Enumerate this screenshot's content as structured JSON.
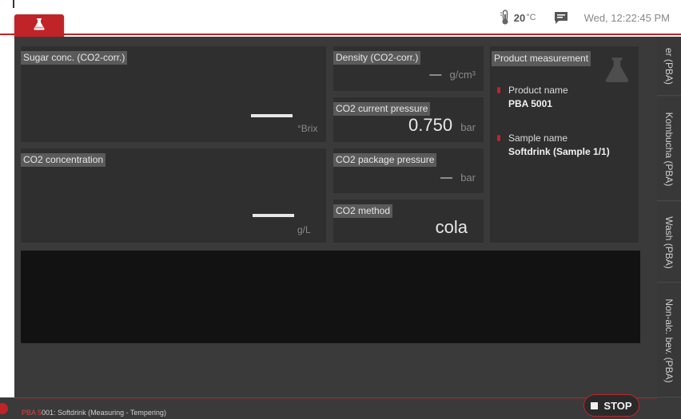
{
  "header": {
    "temperature_value": "20",
    "temperature_unit": "°C",
    "datetime": "Wed, 12:22:45 PM"
  },
  "panels": {
    "sugar": {
      "label": "Sugar conc. (CO2-corr.)",
      "unit": "°Brix"
    },
    "co2_conc": {
      "label": "CO2 concentration",
      "unit": "g/L"
    },
    "density": {
      "label": "Density (CO2-corr.)",
      "value": "—",
      "unit": "g/cm³"
    },
    "co2_current": {
      "label": "CO2 current pressure",
      "value": "0.750",
      "unit": "bar"
    },
    "co2_package": {
      "label": "CO2 package pressure",
      "value": "—",
      "unit": "bar"
    },
    "co2_method": {
      "label": "CO2 method",
      "value": "cola"
    }
  },
  "product": {
    "title": "Product measurement",
    "product_name_label": "Product name",
    "product_name_value": "PBA 5001",
    "sample_name_label": "Sample name",
    "sample_name_value": "Softdrink (Sample 1/1)"
  },
  "side_tabs": [
    {
      "label": "er (PBA)"
    },
    {
      "label": "Kombucha (PBA)"
    },
    {
      "label": "Wash (PBA)"
    },
    {
      "label": "Non-alc. bev. (PBA)"
    }
  ],
  "footer": {
    "status_prefix": "PBA 5",
    "status_rest": "001: Softdrink (Measuring - Tempering)",
    "stop_label": "STOP"
  },
  "colors": {
    "accent": "#c02428",
    "panel_bg": "#2f2f2f",
    "main_bg": "#3a3a3a"
  },
  "icons": {
    "home": "flask-icon",
    "temperature": "thermometer-icon",
    "message": "message-icon",
    "stop": "stop-icon"
  }
}
